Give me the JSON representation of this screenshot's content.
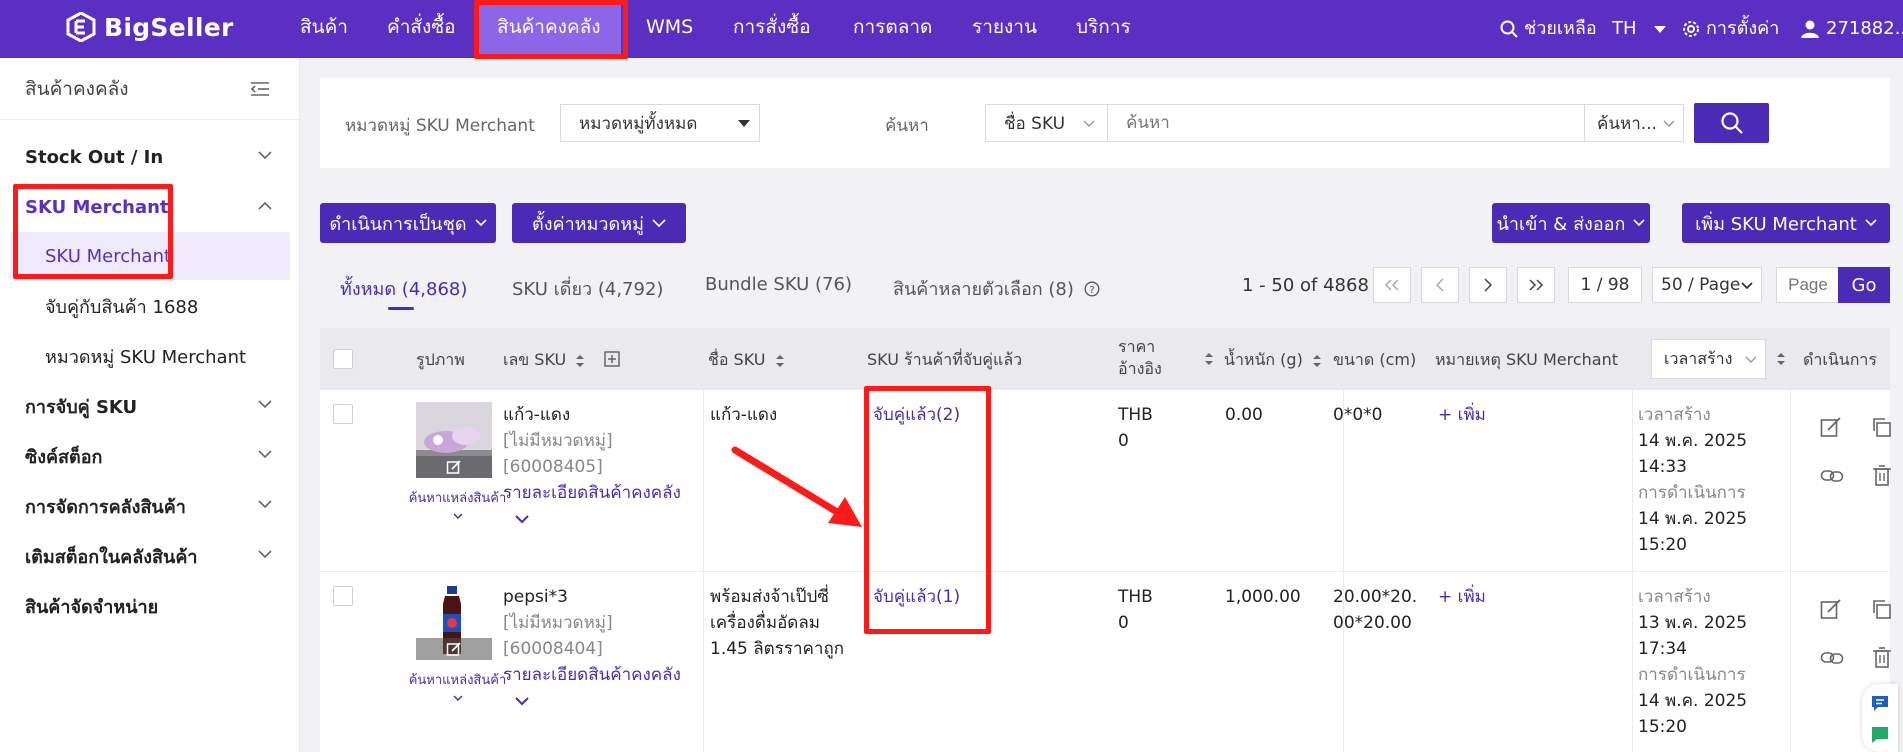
{
  "brand": "BigSeller",
  "nav": {
    "items": [
      "สินค้า",
      "คำสั่งซื้อ",
      "สินค้าคงคลัง",
      "WMS",
      "การสั่งซื้อ",
      "การตลาด",
      "รายงาน",
      "บริการ"
    ],
    "help": "ช่วยเหลือ",
    "lang": "TH",
    "settings": "การตั้งค่า",
    "user": "271882..."
  },
  "sidebar": {
    "title": "สินค้าคงคลัง",
    "groups": {
      "stock": "Stock Out / In",
      "sku_merchant": "SKU Merchant",
      "sku_merchant_item": "SKU Merchant",
      "match_1688": "จับคู่กับสินค้า 1688",
      "category": "หมวดหมู่ SKU Merchant",
      "sku_pairing": "การจับคู่ SKU",
      "sync_stock": "ซิงค์สต็อก",
      "warehouse_mgmt": "การจัดการคลังสินค้า",
      "restock": "เติมสต็อกในคลังสินค้า",
      "distribution": "สินค้าจัดจำหน่าย"
    }
  },
  "filter": {
    "category_label": "หมวดหมู่ SKU Merchant",
    "category_value": "หมวดหมู่ทั้งหมด",
    "search_label": "ค้นหา",
    "search_field": "ชื่อ SKU",
    "search_placeholder": "ค้นหา",
    "search_mode": "ค้นหา..."
  },
  "actions": {
    "bulk": "ดำเนินการเป็นชุด",
    "set_category": "ตั้งค่าหมวดหมู่",
    "import_export": "นำเข้า & ส่งออก",
    "add_sku": "เพิ่ม SKU Merchant"
  },
  "tabs": {
    "all": "ทั้งหมด (4,868)",
    "single": "SKU เดี่ยว (4,792)",
    "bundle": "Bundle SKU (76)",
    "variant": "สินค้าหลายตัวเลือก (8)"
  },
  "pagination": {
    "range": "1 - 50 of 4868",
    "page": "1 / 98",
    "per_page": "50 / Page",
    "page_placeholder": "Page",
    "go": "Go"
  },
  "table": {
    "headers": {
      "image": "รูปภาพ",
      "sku_no": "เลข SKU",
      "sku_name": "ชื่อ SKU",
      "shop_sku": "SKU ร้านค้าที่จับคู่แล้ว",
      "price_1": "ราคา",
      "price_2": "อ้างอิง",
      "weight": "น้ำหนัก (g)",
      "size": "ขนาด (cm)",
      "note": "หมายเหตุ SKU Merchant",
      "time_sort": "เวลาสร้าง",
      "ops": "ดำเนินการ"
    },
    "rows": [
      {
        "sku": "แก้ว-แดง",
        "no_cat": "[ไม่มีหมวดหมู่]",
        "id": "[60008405]",
        "detail": "รายละเอียดสินค้าคงคลัง",
        "source": "ค้นหาแหล่งสินค้า",
        "name": "แก้ว-แดง",
        "name2": "",
        "name3": "",
        "matched": "จับคู่แล้ว(2)",
        "currency": "THB",
        "price": "0",
        "weight": "0.00",
        "size": "0*0*0",
        "size2": "",
        "add_note": "+ เพิ่ม",
        "created_label": "เวลาสร้าง",
        "created_date": "14 พ.ค. 2025",
        "created_time": "14:33",
        "op_label": "การดำเนินการ",
        "op_date": "14 พ.ค. 2025",
        "op_time": "15:20"
      },
      {
        "sku": "pepsi*3",
        "no_cat": "[ไม่มีหมวดหมู่]",
        "id": "[60008404]",
        "detail": "รายละเอียดสินค้าคงคลัง",
        "source": "ค้นหาแหล่งสินค้า",
        "name": "พร้อมส่งจ้าเป๊ปซี่",
        "name2": "เครื่องดื่มอัดลม",
        "name3": "1.45 ลิตรราคาถูก",
        "matched": "จับคู่แล้ว(1)",
        "currency": "THB",
        "price": "0",
        "weight": "1,000.00",
        "size": "20.00*20.",
        "size2": "00*20.00",
        "add_note": "+ เพิ่ม",
        "created_label": "เวลาสร้าง",
        "created_date": "13 พ.ค. 2025",
        "created_time": "17:34",
        "op_label": "การดำเนินการ",
        "op_date": "14 พ.ค. 2025",
        "op_time": "15:20"
      }
    ]
  },
  "colors": {
    "brand": "#5a2fc2",
    "primary": "#4b2bb6",
    "highlight": "#ff1a1a"
  }
}
